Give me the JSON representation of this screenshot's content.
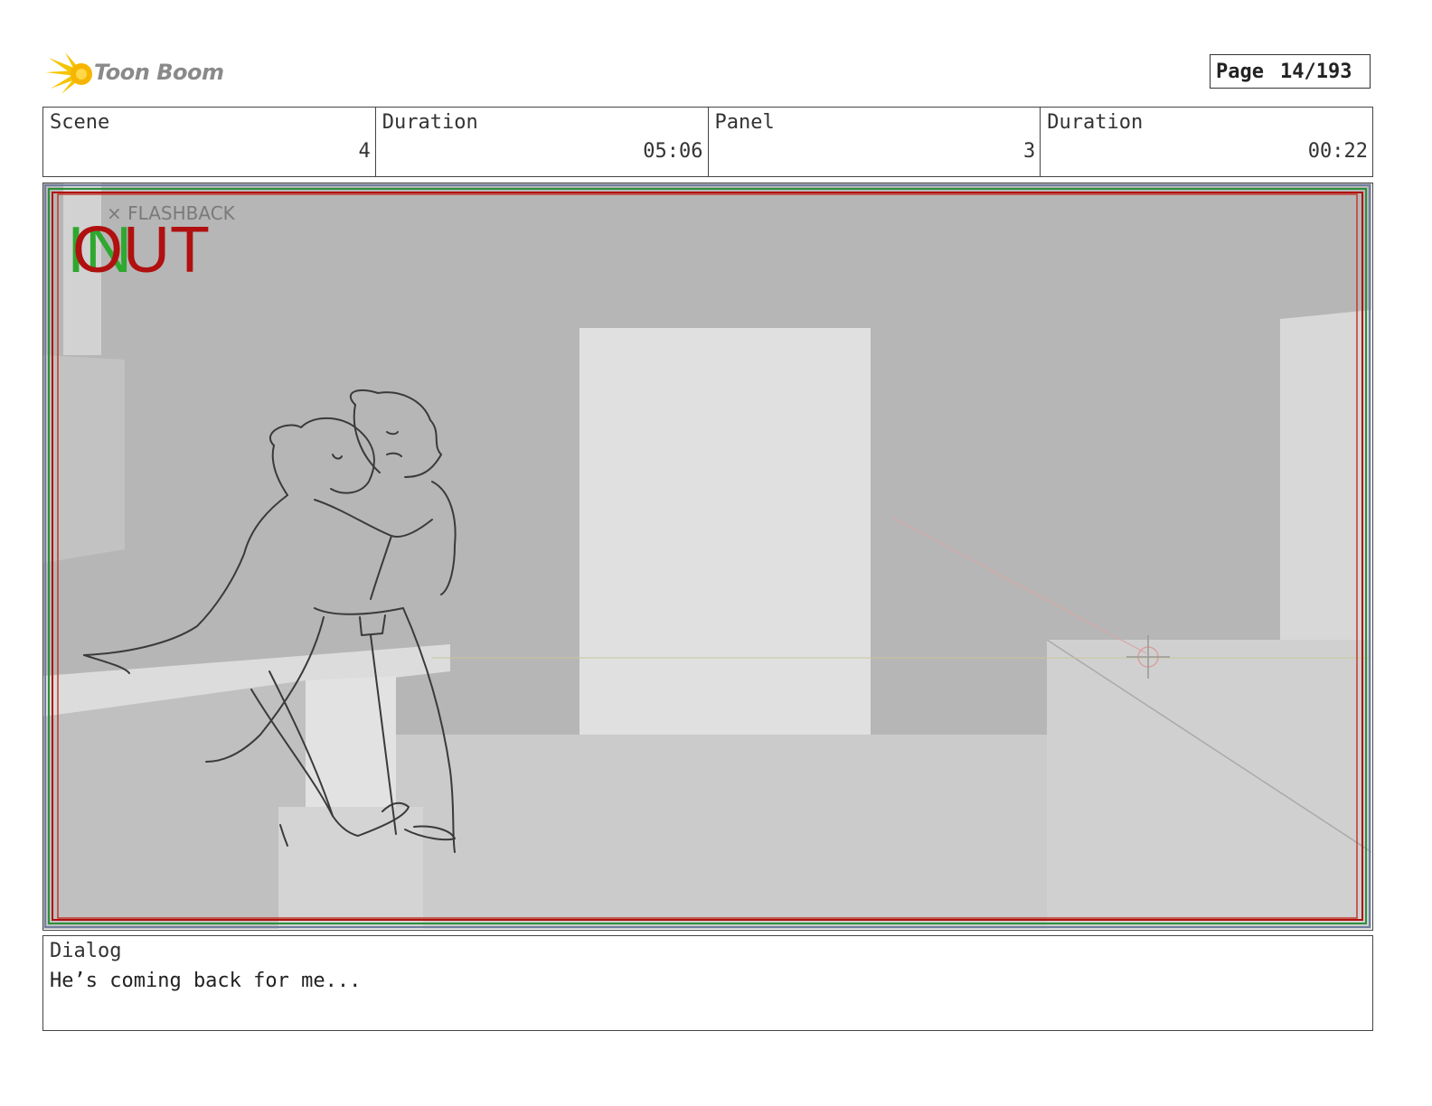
{
  "logo": {
    "text": "Toon Boom",
    "icon": "star-burst-icon"
  },
  "page": {
    "label": "Page",
    "value": "14/193"
  },
  "info": {
    "scene_label": "Scene",
    "scene_value": "4",
    "scene_duration_label": "Duration",
    "scene_duration_value": "05:06",
    "panel_label": "Panel",
    "panel_value": "3",
    "panel_duration_label": "Duration",
    "panel_duration_value": "00:22"
  },
  "panel_art": {
    "note": "× FLASHBACK",
    "in_mark": "IN",
    "out_mark": "OUT",
    "colors": {
      "in": "#2fa82f",
      "out": "#b01010",
      "safe_frame": "#c0392b",
      "background": "#b5b5b5"
    }
  },
  "dialog": {
    "label": "Dialog",
    "text": "He’s coming back for me..."
  }
}
